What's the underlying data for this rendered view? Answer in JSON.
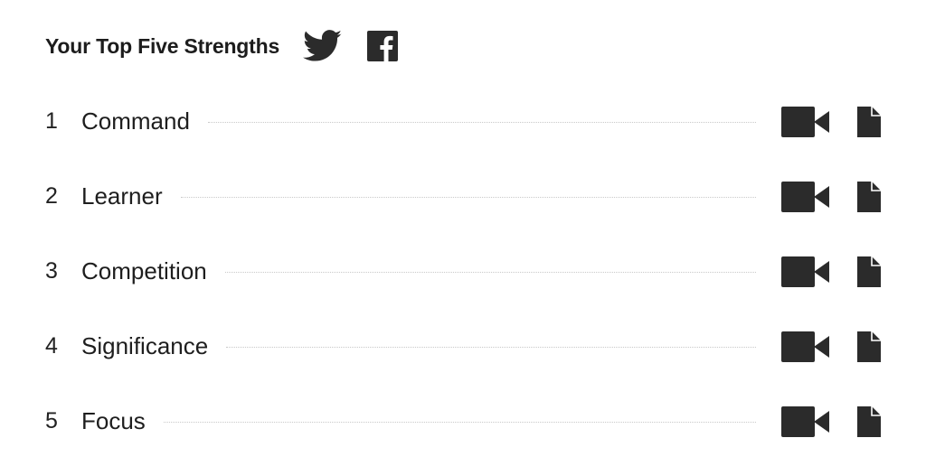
{
  "header": {
    "title": "Your Top Five Strengths",
    "share_icons": [
      "twitter-icon",
      "facebook-icon"
    ]
  },
  "strengths": [
    {
      "rank": "1",
      "name": "Command"
    },
    {
      "rank": "2",
      "name": "Learner"
    },
    {
      "rank": "3",
      "name": "Competition"
    },
    {
      "rank": "4",
      "name": "Significance"
    },
    {
      "rank": "5",
      "name": "Focus"
    }
  ],
  "row_icons": [
    "video-camera-icon",
    "document-icon"
  ],
  "colors": {
    "icon": "#2b2b2b",
    "text": "#1e1e1e",
    "leader": "#c9c9c9"
  }
}
